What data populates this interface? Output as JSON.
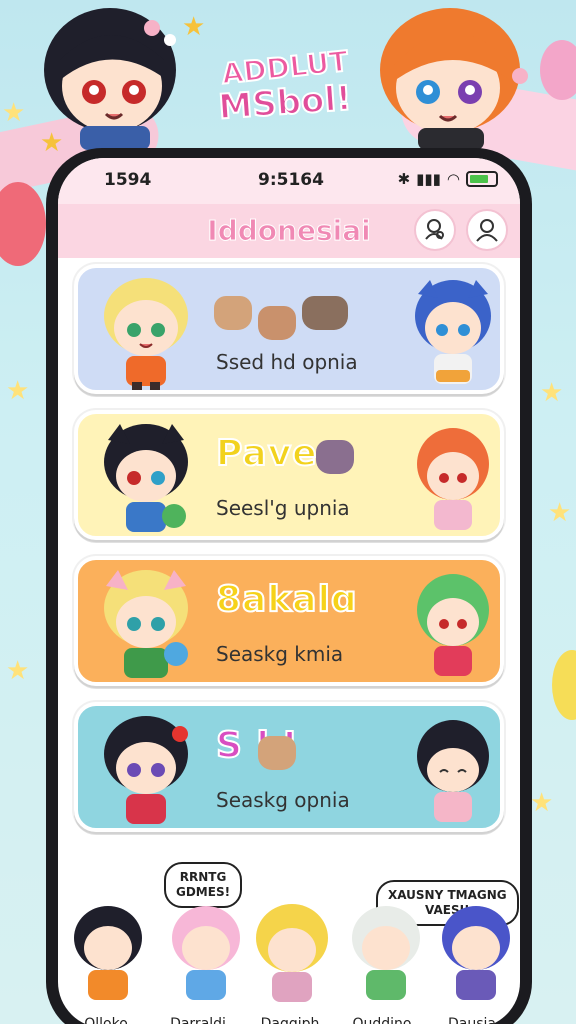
{
  "logo": {
    "line1": "ADDLUT",
    "line2": "MSbol!"
  },
  "status_bar": {
    "carrier": "1594",
    "time": "9:5164"
  },
  "header": {
    "title": "Iddonesiai",
    "search_icon": "search-person-icon",
    "profile_icon": "profile-icon"
  },
  "cards": [
    {
      "title": "",
      "subtitle": "Ssed hd opnia",
      "color": "#cfdcf5",
      "title_color": "#000000"
    },
    {
      "title": "Pave",
      "subtitle": "Seesl'g upnia",
      "color": "#fff3b8",
      "title_color": "#f2d21d"
    },
    {
      "title": "8akalɑ",
      "subtitle": "Seaskg kmia",
      "color": "#fbb05b",
      "title_color": "#f6d21a"
    },
    {
      "title": "S  k!",
      "subtitle": "Seaskg opnia",
      "color": "#8fd5e0",
      "title_color": "#d84ec1"
    }
  ],
  "bottom": {
    "bubble_left": "RRNTG\nGDMES!",
    "bubble_right": "XAUSNY TMAGNG\nVAESI!",
    "names": [
      "Olloko",
      "Darraldi",
      "Daggiph",
      "Ouddino",
      "Dausia"
    ]
  },
  "colors": {
    "accent_pink": "#f089b4",
    "header_bg": "#fbd6e2",
    "battery": "#4cc24a"
  }
}
